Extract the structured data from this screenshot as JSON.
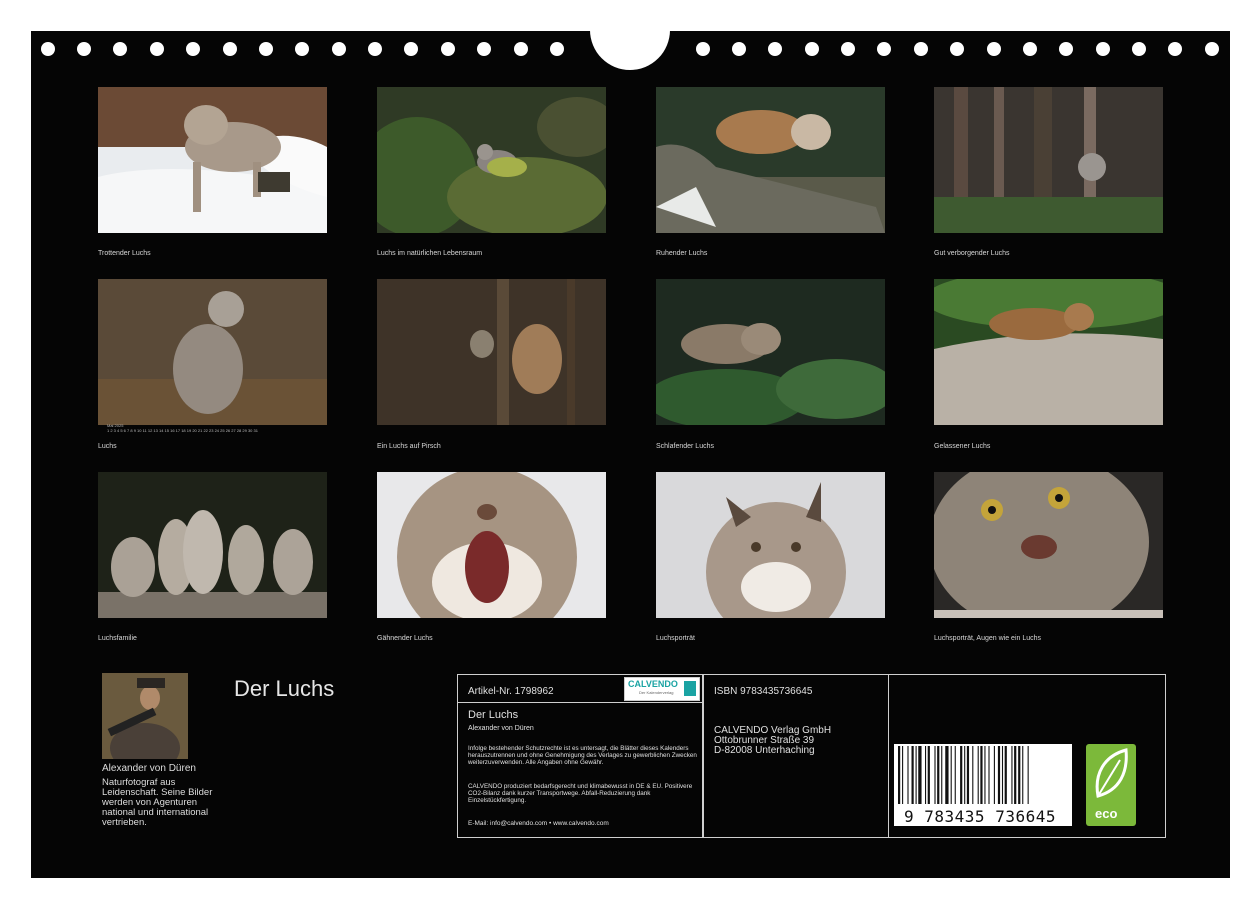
{
  "photos": [
    {
      "caption": "Trottender Luchs"
    },
    {
      "caption": "Luchs im natürlichen Lebensraum"
    },
    {
      "caption": "Ruhender Luchs"
    },
    {
      "caption": "Gut verborgender Luchs"
    },
    {
      "caption": "Luchs"
    },
    {
      "caption": "Ein Luchs auf Pirsch"
    },
    {
      "caption": "Schlafender Luchs"
    },
    {
      "caption": "Gelassener Luchs"
    },
    {
      "caption": "Luchsfamilie"
    },
    {
      "caption": "Gähnender Luchs"
    },
    {
      "caption": "Luchsporträt"
    },
    {
      "caption": "Luchsporträt, Augen wie ein Luchs"
    }
  ],
  "mini_calendar": {
    "month": "Mai 2025",
    "days": "1 2 3 4 5 6 7 8 9 10 11 12 13 14 15 16 17 18 19 20 21 22 23 24 25 26 27 28 29 30 31"
  },
  "author": {
    "name": "Alexander von Düren",
    "bio": "Naturfotograf aus Leidenschaft. Seine Bilder werden von Agenturen national und international vertrieben."
  },
  "calendar_title": "Der Luchs",
  "info": {
    "article_no": "Artikel-Nr. 1798962",
    "logo_text": "CALVENDO",
    "logo_sub": "Der Kalenderverlag",
    "title": "Der Luchs",
    "author": "Alexander von Düren",
    "legal_1": "Infolge bestehender Schutzrechte ist es untersagt, die Blätter dieses Kalenders herauszutrennen und ohne Genehmigung des Verlages zu gewerblichen Zwecken weiterzuverwenden. Alle Angaben ohne Gewähr.",
    "legal_2": "CALVENDO produziert bedarfsgerecht und klimabewusst in DE & EU. Positivere CO2-Bilanz dank kurzer Transportwege. Abfall-Reduzierung dank Einzelstückfertigung.",
    "contact": "E-Mail: info@calvendo.com • www.calvendo.com",
    "isbn": "ISBN 9783435736645",
    "publisher_1": "CALVENDO Verlag GmbH",
    "publisher_2": "Ottobrunner Straße 39",
    "publisher_3": "D-82008 Unterhaching",
    "barcode_digits": "9 783435 736645",
    "eco_label": "eco"
  },
  "colors": {
    "background": "#050505",
    "text": "#e0e0e0",
    "eco_green": "#7cb93a",
    "calvendo_teal": "#1aa3a3"
  }
}
